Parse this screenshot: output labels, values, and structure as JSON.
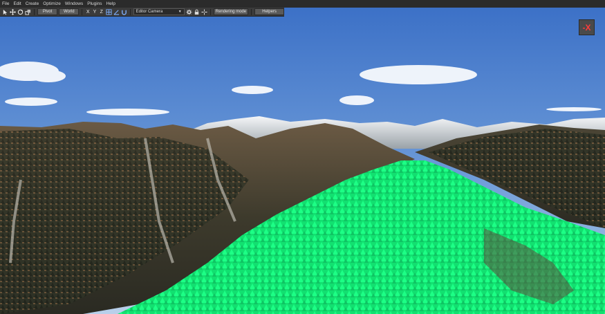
{
  "menu": [
    "File",
    "Edit",
    "Create",
    "Optimize",
    "Windows",
    "Plugins",
    "Help"
  ],
  "toolbar": {
    "pivot_label": "Pivot",
    "world_label": "World",
    "axis_x": "X",
    "axis_y": "Y",
    "axis_z": "Z",
    "camera_value": "Editor Camera",
    "rendering_label": "Rendering mode",
    "helpers_label": "Helpers"
  },
  "close_label": "-X",
  "colors": {
    "sky_top": "#3d72c8",
    "sky_bottom": "#b4cde8",
    "forest_highlight": "#17f07a",
    "close_glyph": "#ff3b3b"
  },
  "icons": [
    "select-arrow-icon",
    "move-icon",
    "rotate-icon",
    "scale-icon",
    "snap-grid-icon",
    "snap-angle-icon",
    "snap-magnet-icon",
    "settings-gear-icon",
    "lock-icon",
    "crosshair-icon"
  ]
}
